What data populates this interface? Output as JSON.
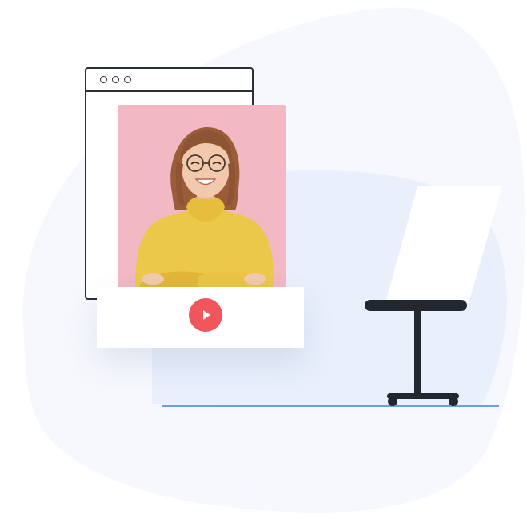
{
  "colors": {
    "background": "#ffffff",
    "blob_outer": "#f6f8fd",
    "blob_inner": "#e9effb",
    "window_stroke": "#2b2f36",
    "card_pink": "#f2b8c3",
    "play_button": "#f2565d",
    "floor_line": "#6f9be8",
    "stool": "#23272e",
    "sweater": "#ecc84a",
    "hair": "#9a5d3a",
    "skin": "#f3c9ad"
  },
  "icons": {
    "play": "play-icon",
    "window_dots": "window-dots-icon"
  }
}
